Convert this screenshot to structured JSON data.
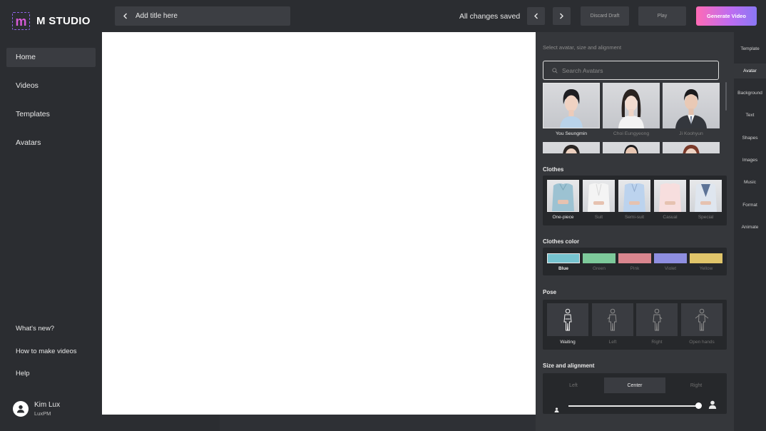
{
  "brand": {
    "mark": "m",
    "name": "M STUDIO"
  },
  "nav": [
    {
      "label": "Home",
      "active": true
    },
    {
      "label": "Videos"
    },
    {
      "label": "Templates"
    },
    {
      "label": "Avatars"
    }
  ],
  "nav_bottom": [
    "What's new?",
    "How to make videos",
    "Help"
  ],
  "user": {
    "name": "Kim Lux",
    "org": "LuxPM"
  },
  "topbar": {
    "title_placeholder": "Add title here",
    "status": "All changes saved",
    "discard_label": "Discard Draft",
    "play_label": "Play",
    "generate_label": "Generate Video"
  },
  "panel": {
    "hint": "Select avatar, size and alignment",
    "search_placeholder": "Search Avatars",
    "avatars": [
      "You Seungmin",
      "Choi Eungyeong",
      "Ji Koohyun"
    ],
    "clothes_title": "Clothes",
    "clothes": [
      "One-piece",
      "Suit",
      "Semi-suit",
      "Casual",
      "Special"
    ],
    "color_title": "Clothes color",
    "colors": [
      {
        "label": "Blue",
        "hex": "#76c3cf"
      },
      {
        "label": "Green",
        "hex": "#7dc99a"
      },
      {
        "label": "Pink",
        "hex": "#d9868e"
      },
      {
        "label": "Violet",
        "hex": "#8e8ee0"
      },
      {
        "label": "Yellow",
        "hex": "#e0c56a"
      }
    ],
    "pose_title": "Pose",
    "poses": [
      "Waiting",
      "Left",
      "Right",
      "Open hands"
    ],
    "size_title": "Size and alignment",
    "align": [
      "Left",
      "Center",
      "Right"
    ],
    "size_value": 1.0
  },
  "tabs": [
    "Template",
    "Avatar",
    "Background",
    "Text",
    "Shapes",
    "Images",
    "Music",
    "Format",
    "Animate"
  ],
  "accent": "#ff6bb5"
}
